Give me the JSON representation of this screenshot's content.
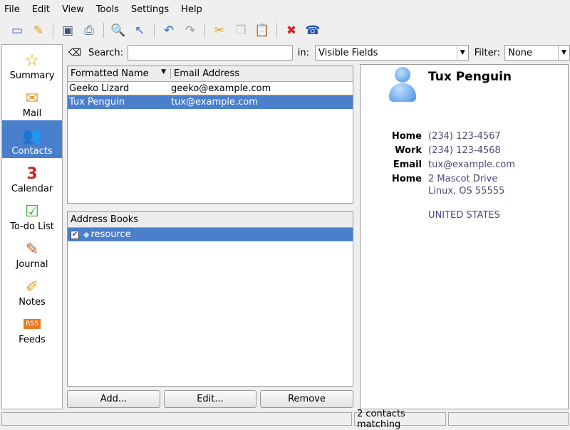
{
  "menu": [
    "File",
    "Edit",
    "View",
    "Tools",
    "Settings",
    "Help"
  ],
  "toolbar": [
    "new-contact-icon",
    "edit-icon",
    "save-icon",
    "print-icon",
    "find-icon",
    "whats-this-icon",
    "undo-icon",
    "redo-icon",
    "cut-icon",
    "copy-icon",
    "paste-icon",
    "delete-icon",
    "phone-icon"
  ],
  "sidebar": [
    {
      "label": "Summary",
      "icon": "☆"
    },
    {
      "label": "Mail",
      "icon": "✉"
    },
    {
      "label": "Contacts",
      "icon": "👥"
    },
    {
      "label": "Calendar",
      "icon": "3"
    },
    {
      "label": "To-do List",
      "icon": "☑"
    },
    {
      "label": "Journal",
      "icon": "✎"
    },
    {
      "label": "Notes",
      "icon": "✐"
    },
    {
      "label": "Feeds",
      "icon": "RSS"
    }
  ],
  "search": {
    "label": "Search:",
    "value": "",
    "in_label": "in:",
    "in_value": "Visible Fields",
    "filter_label": "Filter:",
    "filter_value": "None"
  },
  "contacts": {
    "columns": [
      "Formatted Name",
      "Email Address"
    ],
    "rows": [
      {
        "name": "Geeko Lizard",
        "email": "geeko@example.com"
      },
      {
        "name": "Tux Penguin",
        "email": "tux@example.com"
      }
    ]
  },
  "address_books": {
    "header": "Address Books",
    "items": [
      "resource"
    ]
  },
  "buttons": {
    "add": "Add...",
    "edit": "Edit...",
    "remove": "Remove"
  },
  "detail": {
    "name": "Tux Penguin",
    "fields": [
      {
        "label": "Home",
        "value": "(234) 123-4567"
      },
      {
        "label": "Work",
        "value": "(234) 123-4568"
      },
      {
        "label": "Email",
        "value": "tux@example.com"
      },
      {
        "label": "Home",
        "value": "2 Mascot Drive"
      }
    ],
    "address_line2": "Linux, OS 55555",
    "country": "UNITED STATES"
  },
  "status": {
    "middle": "2 contacts matching"
  }
}
